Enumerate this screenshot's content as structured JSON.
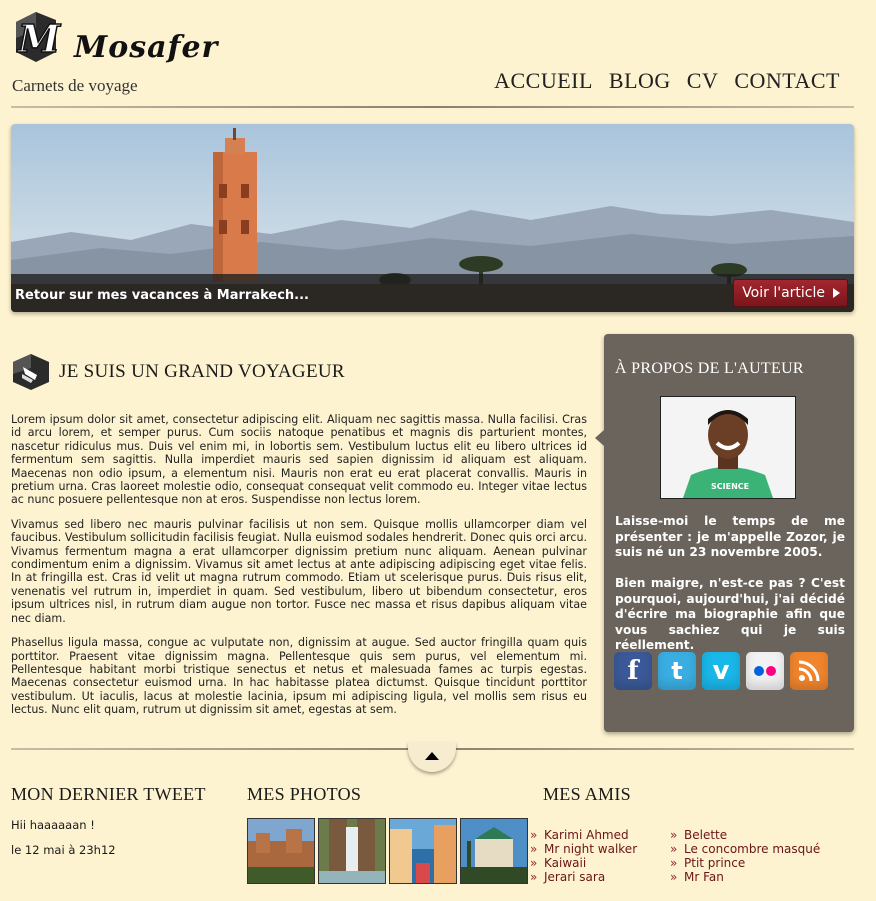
{
  "header": {
    "logo_letter": "M",
    "site_name": "Mosafer",
    "tagline": "Carnets de voyage",
    "nav": [
      "ACCUEIL",
      "BLOG",
      "CV",
      "CONTACT"
    ]
  },
  "banner": {
    "caption": "Retour sur mes vacances à Marrakech...",
    "button_label": "Voir l'article"
  },
  "article": {
    "title": "JE SUIS UN GRAND VOYAGEUR",
    "paragraphs": [
      "Lorem ipsum dolor sit amet, consectetur adipiscing elit. Aliquam nec sagittis massa. Nulla facilisi. Cras id arcu lorem, et semper purus. Cum sociis natoque penatibus et magnis dis parturient montes, nascetur ridiculus mus. Duis vel enim mi, in lobortis sem. Vestibulum luctus elit eu libero ultrices id fermentum sem sagittis. Nulla imperdiet mauris sed sapien dignissim id aliquam est aliquam. Maecenas non odio ipsum, a elementum nisi. Mauris non erat eu erat placerat convallis. Mauris in pretium urna. Cras laoreet molestie odio, consequat consequat velit commodo eu. Integer vitae lectus ac nunc posuere pellentesque non at eros. Suspendisse non lectus lorem.",
      "Vivamus sed libero nec mauris pulvinar facilisis ut non sem. Quisque mollis ullamcorper diam vel faucibus. Vestibulum sollicitudin facilisis feugiat. Nulla euismod sodales hendrerit. Donec quis orci arcu. Vivamus fermentum magna a erat ullamcorper dignissim pretium nunc aliquam. Aenean pulvinar condimentum enim a dignissim. Vivamus sit amet lectus at ante adipiscing adipiscing eget vitae felis. In at fringilla est. Cras id velit ut magna rutrum commodo. Etiam ut scelerisque purus. Duis risus elit, venenatis vel rutrum in, imperdiet in quam. Sed vestibulum, libero ut bibendum consectetur, eros ipsum ultrices nisl, in rutrum diam augue non tortor. Fusce nec massa et risus dapibus aliquam vitae nec diam.",
      "Phasellus ligula massa, congue ac vulputate non, dignissim at augue. Sed auctor fringilla quam quis porttitor. Praesent vitae dignissim magna. Pellentesque quis sem purus, vel elementum mi. Pellentesque habitant morbi tristique senectus et netus et malesuada fames ac turpis egestas. Maecenas consectetur euismod urna. In hac habitasse platea dictumst. Quisque tincidunt porttitor vestibulum. Ut iaculis, lacus at molestie lacinia, ipsum mi adipiscing ligula, vel mollis sem risus eu lectus. Nunc elit quam, rutrum ut dignissim sit amet, egestas at sem."
    ]
  },
  "aside": {
    "title": "À PROPOS DE L'AUTEUR",
    "paragraphs": [
      "Laisse-moi le temps de me présenter : je m'appelle Zozor, je suis né un 23 novembre 2005.",
      "Bien maigre, n'est-ce pas ? C'est pourquoi, aujourd'hui, j'ai décidé d'écrire ma biographie afin que vous sachiez qui je suis réellement."
    ],
    "social": [
      {
        "icon": "facebook-icon",
        "glyph": "f",
        "color": "#3b5998"
      },
      {
        "icon": "twitter-icon",
        "glyph": "t",
        "color": "#3aaee2"
      },
      {
        "icon": "vimeo-icon",
        "glyph": "v",
        "color": "#1ab7ea"
      },
      {
        "icon": "flickr-icon",
        "glyph": "••",
        "color": "#f2f2f2"
      },
      {
        "icon": "rss-icon",
        "glyph": ")",
        "color": "#f0852d"
      }
    ]
  },
  "footer": {
    "tweet_title": "MON DERNIER TWEET",
    "tweet_text": "Hii haaaaaan !",
    "tweet_date": "le 12 mai à 23h12",
    "photos_title": "MES PHOTOS",
    "friends_title": "MES AMIS",
    "friends_col1": [
      "Karimi Ahmed",
      "Mr night walker",
      "Kaiwaii",
      "Jerari sara"
    ],
    "friends_col2": [
      "Belette",
      "Le concombre masqué",
      "Ptit prince",
      "Mr Fan"
    ]
  }
}
